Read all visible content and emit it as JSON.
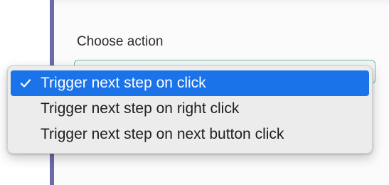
{
  "form": {
    "label": "Choose action"
  },
  "dropdown": {
    "selected_index": 0,
    "options": [
      {
        "label": "Trigger next step on click",
        "selected": true
      },
      {
        "label": "Trigger next step on right click",
        "selected": false
      },
      {
        "label": "Trigger next step on next button click",
        "selected": false
      }
    ],
    "check_icon": "checkmark-icon",
    "highlight_color": "#1a73e8"
  },
  "theme": {
    "accent_line_color": "#6f6aa8",
    "select_border_color": "#6cb89b"
  }
}
